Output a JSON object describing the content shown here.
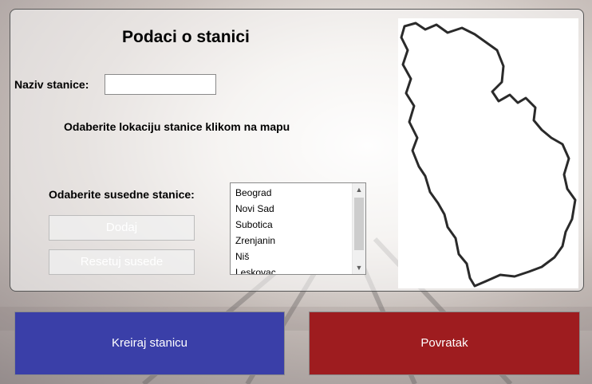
{
  "form": {
    "title": "Podaci o stanici",
    "name_label": "Naziv stanice:",
    "name_value": "",
    "map_hint": "Odaberite lokaciju stanice klikom na mapu",
    "neighbors_label": "Odaberite susedne stanice:",
    "add_label": "Dodaj",
    "reset_label": "Resetuj susede"
  },
  "stations": [
    "Beograd",
    "Novi Sad",
    "Subotica",
    "Zrenjanin",
    "Niš",
    "Leskovac"
  ],
  "map": {
    "icon": "serbia-map-outline"
  },
  "actions": {
    "create_label": "Kreiraj stanicu",
    "create_color": "#3a3fa8",
    "back_label": "Povratak",
    "back_color": "#9e1c1f"
  }
}
